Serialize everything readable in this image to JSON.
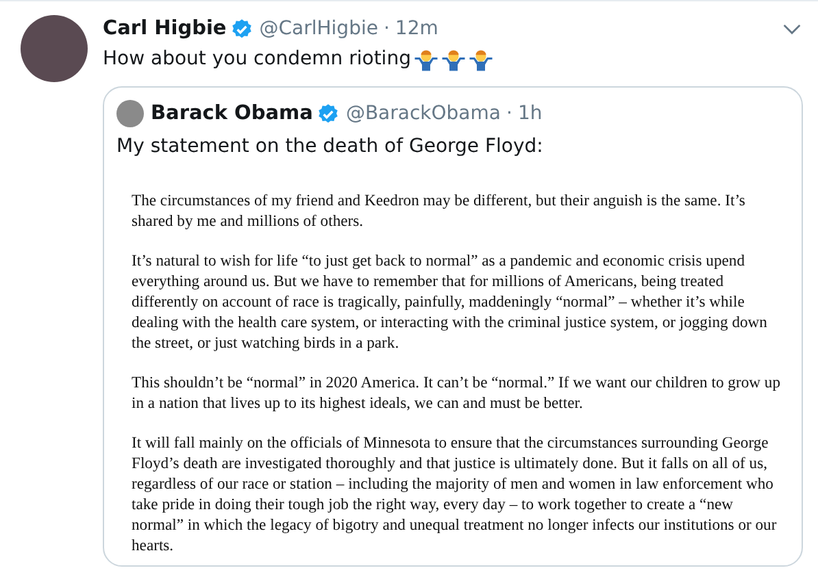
{
  "tweet": {
    "name": "Carl Higbie",
    "verified": true,
    "handle": "@CarlHigbie",
    "separator": "·",
    "time": "12m",
    "text": "How about you condemn rioting",
    "emojis": [
      {
        "kind": "man-shrugging"
      },
      {
        "kind": "man-shrugging"
      },
      {
        "kind": "man-shrugging"
      }
    ],
    "quoted": {
      "name": "Barack Obama",
      "verified": true,
      "handle": "@BarackObama",
      "separator": "·",
      "time": "1h",
      "text": "My statement on the death of George Floyd:",
      "document": {
        "paragraphs": [
          "The circumstances of my friend and Keedron may be different, but their anguish is the same. It’s shared by me and millions of others.",
          "It’s natural to wish for life “to just get back to normal” as a pandemic and economic crisis upend everything around us. But we have to remember that for millions of Americans, being treated differently on account of race is tragically, painfully, maddeningly “normal” – whether it’s while dealing with the health care system, or interacting with the criminal justice system, or jogging down the street, or just watching birds in a park.",
          "This shouldn’t be “normal” in 2020 America. It can’t be “normal.” If we want our children to grow up in a nation that lives up to its highest ideals, we can and must be better.",
          "It will fall mainly on the officials of Minnesota to ensure that the circumstances surrounding George Floyd’s death are investigated thoroughly and that justice is ultimately done. But it falls on all of us, regardless of our race or station – including the majority of men and women in law enforcement who take pride in doing their tough job the right way, every day – to work together to create a “new normal” in which the legacy of bigotry and unequal treatment no longer infects our institutions or our hearts."
        ]
      }
    }
  }
}
